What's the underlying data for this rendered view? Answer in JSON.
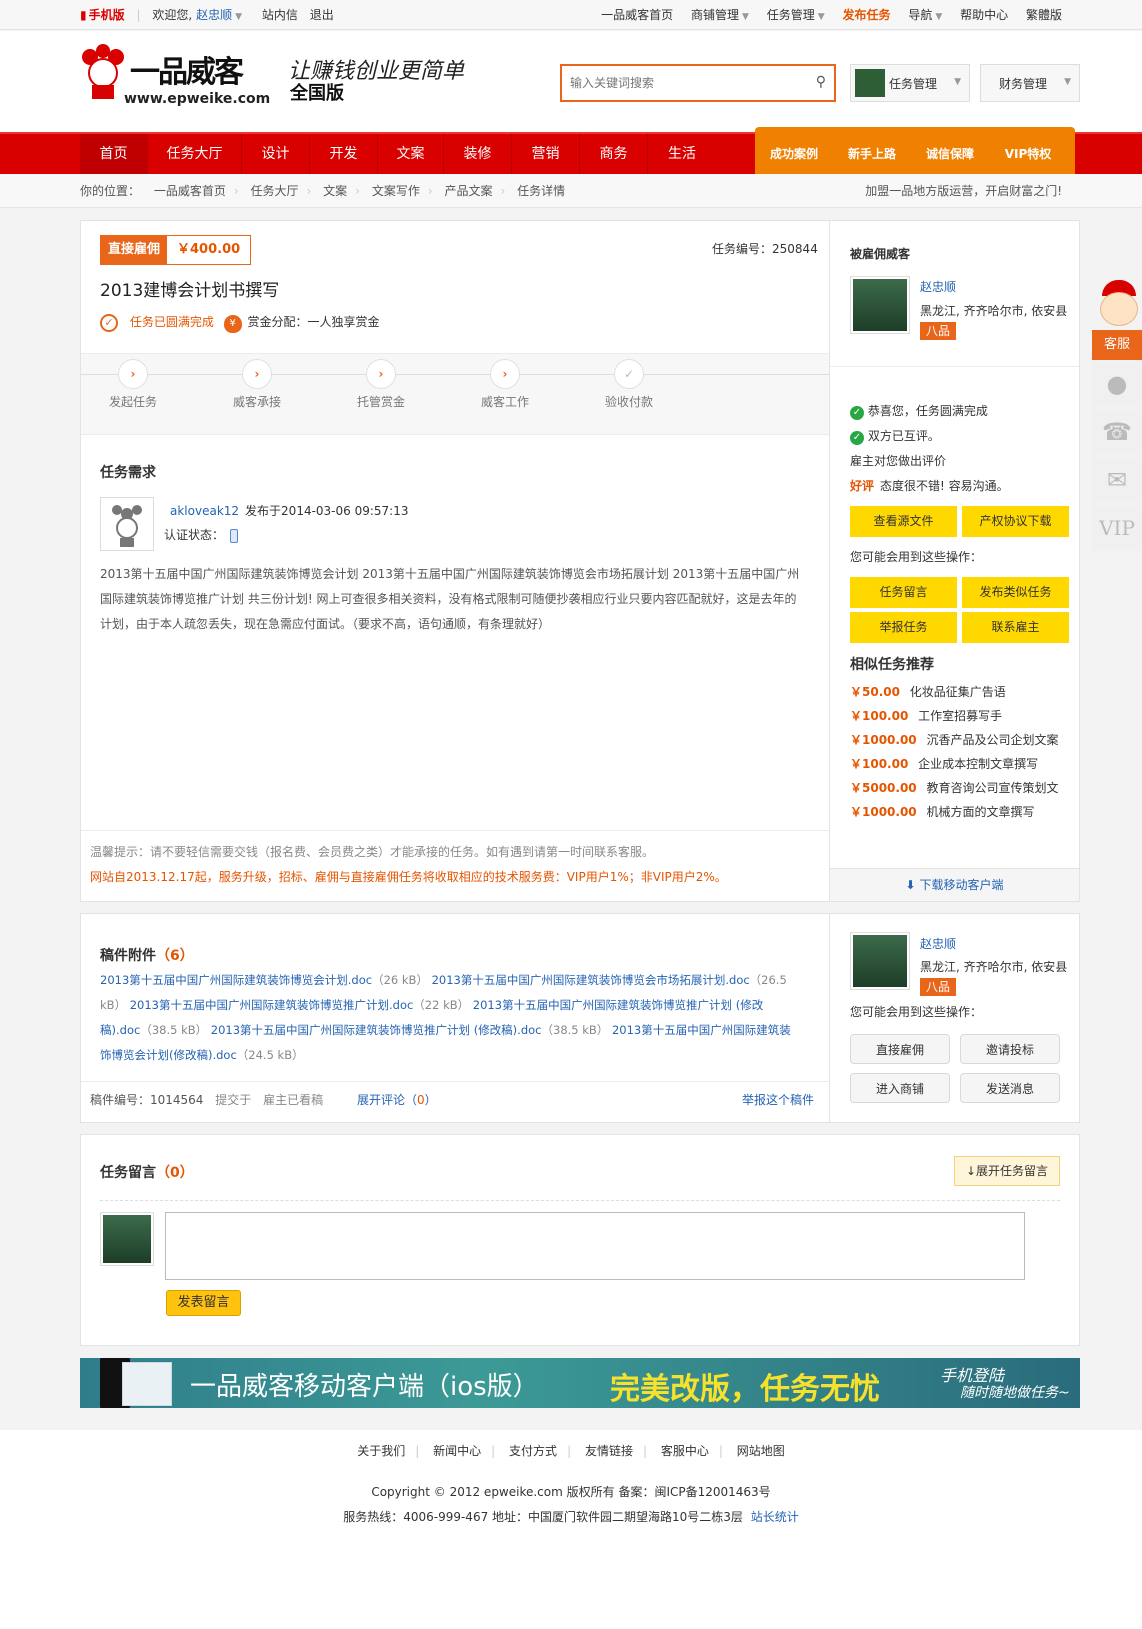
{
  "topbar": {
    "mobile": "手机版",
    "welcome": "欢迎您,",
    "user": "赵忠顺",
    "message": "站内信",
    "logout": "退出",
    "links": [
      "一品威客首页",
      "商铺管理",
      "任务管理",
      "发布任务",
      "导航",
      "帮助中心",
      "繁體版"
    ]
  },
  "header": {
    "logo_text": "一品威客",
    "logo_url": "www.epweike.com",
    "slogan": "让赚钱创业更简单",
    "edition": "全国版",
    "search_placeholder": "输入关键词搜索",
    "task_mgmt": "任务管理",
    "finance_mgmt": "财务管理"
  },
  "nav": {
    "items": [
      "首页",
      "任务大厅",
      "设计",
      "开发",
      "文案",
      "装修",
      "营销",
      "商务",
      "生活"
    ],
    "right": [
      "成功案例",
      "新手上路",
      "诚信保障",
      "VIP特权"
    ]
  },
  "breadcrumb": {
    "label": "你的位置：",
    "items": [
      "一品威客首页",
      "任务大厅",
      "文案",
      "文案写作",
      "产品文案",
      "任务详情"
    ],
    "promo": "加盟一品地方版运营，开启财富之门!"
  },
  "task": {
    "type": "直接雇佣",
    "price": "￥400.00",
    "id_label": "任务编号：",
    "id": "250844",
    "title": "2013建博会计划书撰写",
    "status": "任务已圆满完成",
    "reward_label": "赏金分配：",
    "reward": "一人独享赏金",
    "steps": [
      "发起任务",
      "威客承接",
      "托管赏金",
      "威客工作",
      "验收付款"
    ],
    "req_title": "任务需求",
    "poster": "akloveak12",
    "posted": "发布于2014-03-06 09:57:13",
    "auth": "认证状态：",
    "desc": "2013第十五届中国广州国际建筑装饰博览会计划 2013第十五届中国广州国际建筑装饰博览会市场拓展计划 2013第十五届中国广州国际建筑装饰博览推广计划 共三份计划! 网上可查很多相关资料，没有格式限制可随便抄袭相应行业只要内容匹配就好，这是去年的计划，由于本人疏忽丢失，现在急需应付面试。（要求不高，语句通顺，有条理就好）",
    "tip": "温馨提示：请不要轻信需要交钱（报名费、会员费之类）才能承接的任务。如有遇到请第一时间联系客服。",
    "notice": "网站自2013.12.17起，服务升级，招标、雇佣与直接雇佣任务将收取相应的技术服务费：VIP用户1%；非VIP用户2%。"
  },
  "hired": {
    "title": "被雇佣威客",
    "name": "赵忠顺",
    "location": "黑龙江, 齐齐哈尔市, 依安县",
    "level": "八品",
    "msgs": [
      "恭喜您，任务圆满完成",
      "双方已互评。",
      "雇主对您做出评价"
    ],
    "good": "好评",
    "good_text": "态度很不错! 容易沟通。",
    "btn_source": "查看源文件",
    "btn_ip": "产权协议下载",
    "ops": "您可能会用到这些操作：",
    "btn_msg": "任务留言",
    "btn_similar": "发布类似任务",
    "btn_report": "举报任务",
    "btn_contact": "联系雇主",
    "similar_title": "相似任务推荐",
    "similar": [
      {
        "price": "￥50.00",
        "name": "化妆品征集广告语"
      },
      {
        "price": "￥100.00",
        "name": "工作室招募写手"
      },
      {
        "price": "￥1000.00",
        "name": "沉香产品及公司企划文案"
      },
      {
        "price": "￥100.00",
        "name": "企业成本控制文章撰写"
      },
      {
        "price": "￥5000.00",
        "name": "教育咨询公司宣传策划文"
      },
      {
        "price": "￥1000.00",
        "name": "机械方面的文章撰写"
      }
    ],
    "download": "下载移动客户端"
  },
  "attach": {
    "title": "稿件附件",
    "count": "6",
    "files": [
      {
        "name": "2013第十五届中国广州国际建筑装饰博览会计划.doc",
        "size": "26 kB"
      },
      {
        "name": "2013第十五届中国广州国际建筑装饰博览会市场拓展计划.doc",
        "size": "26.5 kB"
      },
      {
        "name": "2013第十五届中国广州国际建筑装饰博览推广计划.doc",
        "size": "22 kB"
      },
      {
        "name": "2013第十五届中国广州国际建筑装饰博览推广计划 (修改稿).doc",
        "size": "38.5 kB"
      },
      {
        "name": "2013第十五届中国广州国际建筑装饰博览推广计划 (修改稿).doc",
        "size": "38.5 kB"
      },
      {
        "name": "2013第十五届中国广州国际建筑装饰博览会计划(修改稿).doc",
        "size": "24.5 kB"
      }
    ],
    "draft_no": "稿件编号：1014564",
    "submitted": "提交于",
    "read": "雇主已看稿",
    "expand": "展开评论",
    "comments": "0",
    "report": "举报这个稿件",
    "name": "赵忠顺",
    "location": "黑龙江, 齐齐哈尔市, 依安县",
    "level": "八品",
    "ops": "您可能会用到这些操作：",
    "btns": [
      "直接雇佣",
      "邀请投标",
      "进入商铺",
      "发送消息"
    ]
  },
  "comments": {
    "title": "任务留言",
    "count": "0",
    "expand": "↓展开任务留言",
    "submit": "发表留言"
  },
  "banner": {
    "text1": "一品威客移动客户端（ios版）",
    "text2": "完美改版，任务无忧",
    "text3": "手机登陆",
    "text4": "随时随地做任务~"
  },
  "side": {
    "service": "客服",
    "vip": "VIP"
  },
  "footer": {
    "links": [
      "关于我们",
      "新闻中心",
      "支付方式",
      "友情链接",
      "客服中心",
      "网站地图"
    ],
    "copyright": "Copyright © 2012 epweike.com 版权所有 备案：闽ICP备12001463号",
    "hotline": "服务热线：4006-999-467 地址：中国厦门软件园二期望海路10号二栋3层",
    "stats": "站长统计"
  }
}
